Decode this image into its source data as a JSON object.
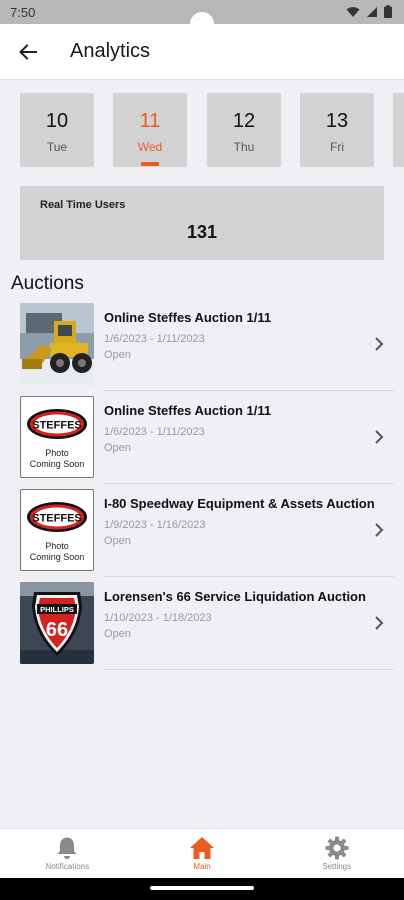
{
  "status_bar": {
    "time": "7:50"
  },
  "app_bar": {
    "title": "Analytics",
    "back_icon": "arrow-left-icon"
  },
  "date_selector": {
    "days": [
      {
        "num": "10",
        "day": "Tue"
      },
      {
        "num": "11",
        "day": "Wed",
        "selected": true
      },
      {
        "num": "12",
        "day": "Thu"
      },
      {
        "num": "13",
        "day": "Fri"
      }
    ],
    "accent_color": "#ef5a1f"
  },
  "realtime": {
    "label": "Real Time Users",
    "value": "131"
  },
  "auctions": {
    "title": "Auctions",
    "items": [
      {
        "title": "Online Steffes Auction 1/11",
        "dates": "1/6/2023 - 1/11/2023",
        "status": "Open",
        "thumb": "wheel-loader-photo"
      },
      {
        "title": "Online Steffes Auction 1/11",
        "dates": "1/6/2023 - 1/11/2023",
        "status": "Open",
        "thumb": "photo-coming-soon",
        "thumb_text": [
          "Photo",
          "Coming Soon"
        ],
        "logo_text": "STEFFES"
      },
      {
        "title": "I-80 Speedway Equipment & Assets Auction",
        "dates": "1/9/2023 - 1/16/2023",
        "status": "Open",
        "thumb": "photo-coming-soon",
        "thumb_text": [
          "Photo",
          "Coming Soon"
        ],
        "logo_text": "STEFFES"
      },
      {
        "title": "Lorensen's 66 Service Liquidation Auction",
        "dates": "1/10/2023 - 1/18/2023",
        "status": "Open",
        "thumb": "phillips-66-sign-photo",
        "logo_text": [
          "PHILLIPS",
          "66"
        ]
      }
    ]
  },
  "bottom_nav": {
    "items": [
      {
        "label": "Notifications",
        "icon": "bell-icon"
      },
      {
        "label": "Main",
        "icon": "home-icon",
        "active": true
      },
      {
        "label": "Settings",
        "icon": "gear-icon"
      }
    ]
  }
}
